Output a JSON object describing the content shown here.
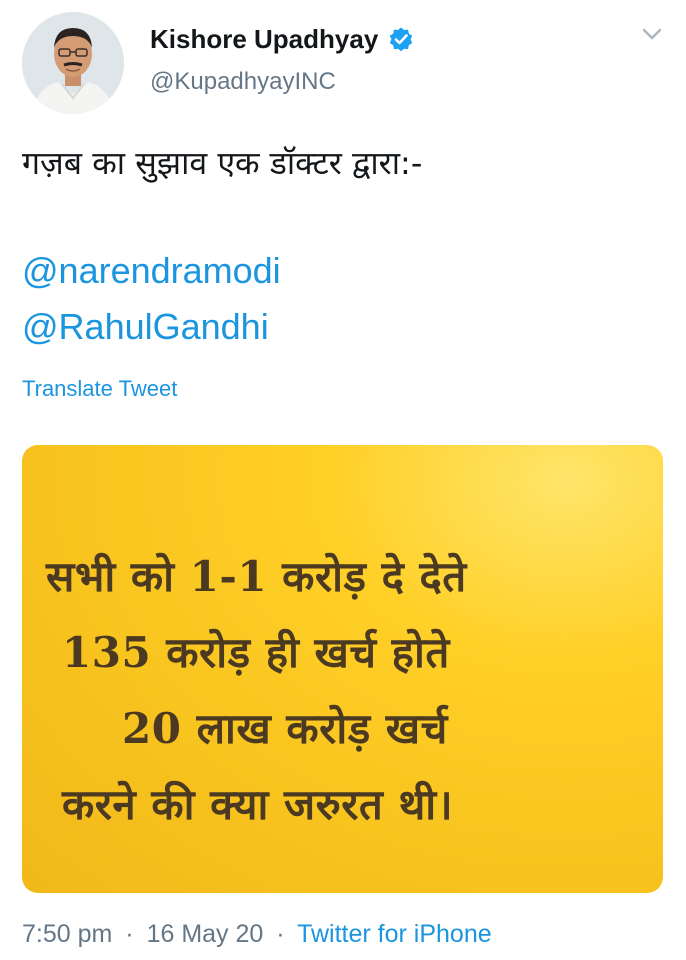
{
  "author": {
    "display_name": "Kishore Upadhyay",
    "handle": "@KupadhyayINC",
    "verified": true
  },
  "tweet": {
    "text": "गज़ब का सुझाव एक डॉक्टर द्वारा:-",
    "mentions": [
      "@narendramodi",
      "@RahulGandhi"
    ],
    "translate_label": "Translate Tweet"
  },
  "media": {
    "background_color": "#f7c21d",
    "text_color": "#4b3a21",
    "lines": [
      "सभी को 1-1 करोड़ दे देते",
      "135 करोड़ ही खर्च होते",
      "20 लाख करोड़ खर्च",
      "करने की क्या जरुरत थी।"
    ]
  },
  "meta": {
    "time": "7:50 pm",
    "date": "16 May 20",
    "separator": "·",
    "source": "Twitter for iPhone"
  },
  "colors": {
    "link": "#1b95e0",
    "secondary_text": "#657786",
    "verified_badge": "#1da1f2"
  },
  "icons": {
    "verified": "verified-badge-icon",
    "caret": "chevron-down-icon"
  }
}
